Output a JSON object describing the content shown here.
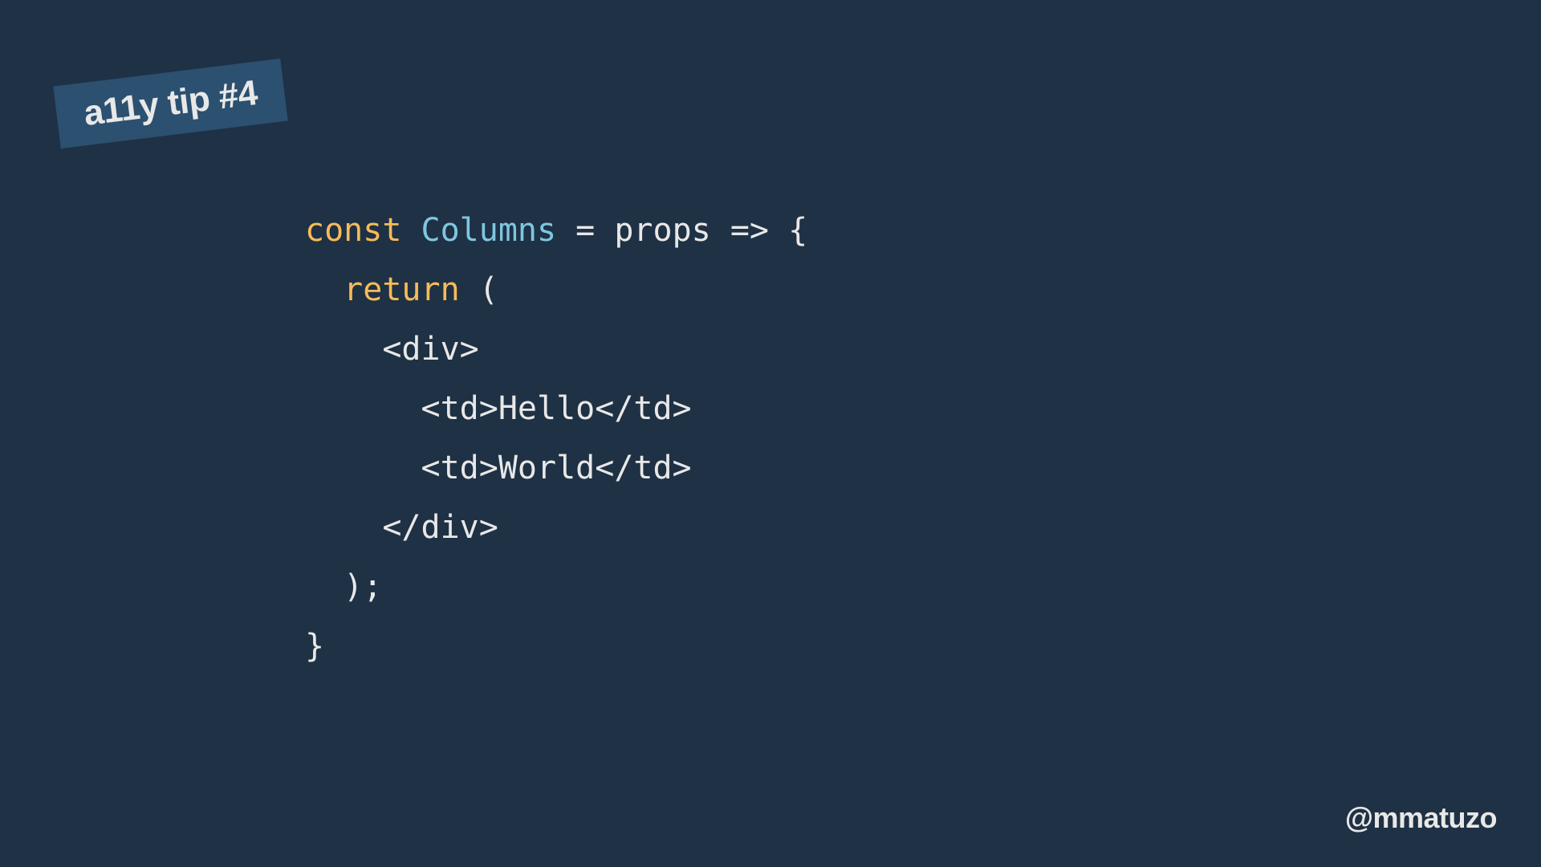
{
  "badge": "a11y tip #4",
  "code": {
    "l1": {
      "kw": "const",
      "name": " Columns",
      "rest": " = props => {"
    },
    "l2": {
      "pad": "  ",
      "kw": "return",
      "rest": " ("
    },
    "l3": "    <div>",
    "l4": "      <td>Hello</td>",
    "l5": "      <td>World</td>",
    "l6": "    </div>",
    "l7": "  );",
    "l8": "}"
  },
  "credit": "@mmatuzo"
}
